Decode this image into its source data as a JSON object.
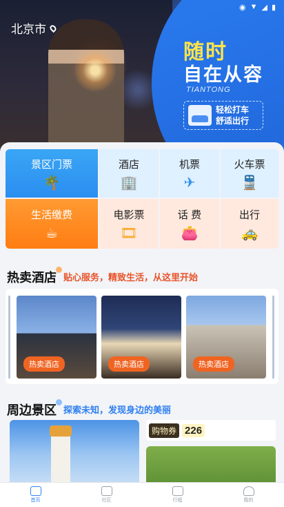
{
  "hero": {
    "city": "北京市",
    "slogan_line1": "随时",
    "slogan_line2": "自在从容",
    "script_text": "TIANTONG",
    "taxi_line1": "轻松打车",
    "taxi_line2": "舒适出行"
  },
  "services": [
    {
      "label": "景区门票",
      "icon": "palm-tree-icon"
    },
    {
      "label": "酒店",
      "icon": "hotel-building-icon"
    },
    {
      "label": "机票",
      "icon": "airplane-icon"
    },
    {
      "label": "火车票",
      "icon": "train-icon"
    },
    {
      "label": "生活缴费",
      "icon": "cup-icon"
    },
    {
      "label": "电影票",
      "icon": "film-reel-icon"
    },
    {
      "label": "话 费",
      "icon": "wallet-icon"
    },
    {
      "label": "出行",
      "icon": "taxi-icon"
    }
  ],
  "hot_hotels": {
    "title": "热卖酒店",
    "subtitle": "贴心服务，精致生活，从这里开始",
    "cards": [
      {
        "badge": "热卖酒店"
      },
      {
        "badge": "热卖酒店"
      },
      {
        "badge": "热卖酒店"
      }
    ]
  },
  "nearby": {
    "title": "周边景区",
    "subtitle": "探索未知，发现身边的美丽",
    "deal_label": "购物券",
    "deal_value": "226"
  },
  "nav": [
    {
      "label": "首页",
      "icon": "home-icon",
      "active": true
    },
    {
      "label": "社区",
      "icon": "community-icon",
      "active": false
    },
    {
      "label": "行程",
      "icon": "trip-icon",
      "active": false
    },
    {
      "label": "我的",
      "icon": "profile-icon",
      "active": false
    }
  ],
  "colors": {
    "primary": "#2f7ff0",
    "orange": "#ff8a1f",
    "hotel_subtitle": "#e8542a",
    "nearby_subtitle": "#2f7ff0"
  }
}
